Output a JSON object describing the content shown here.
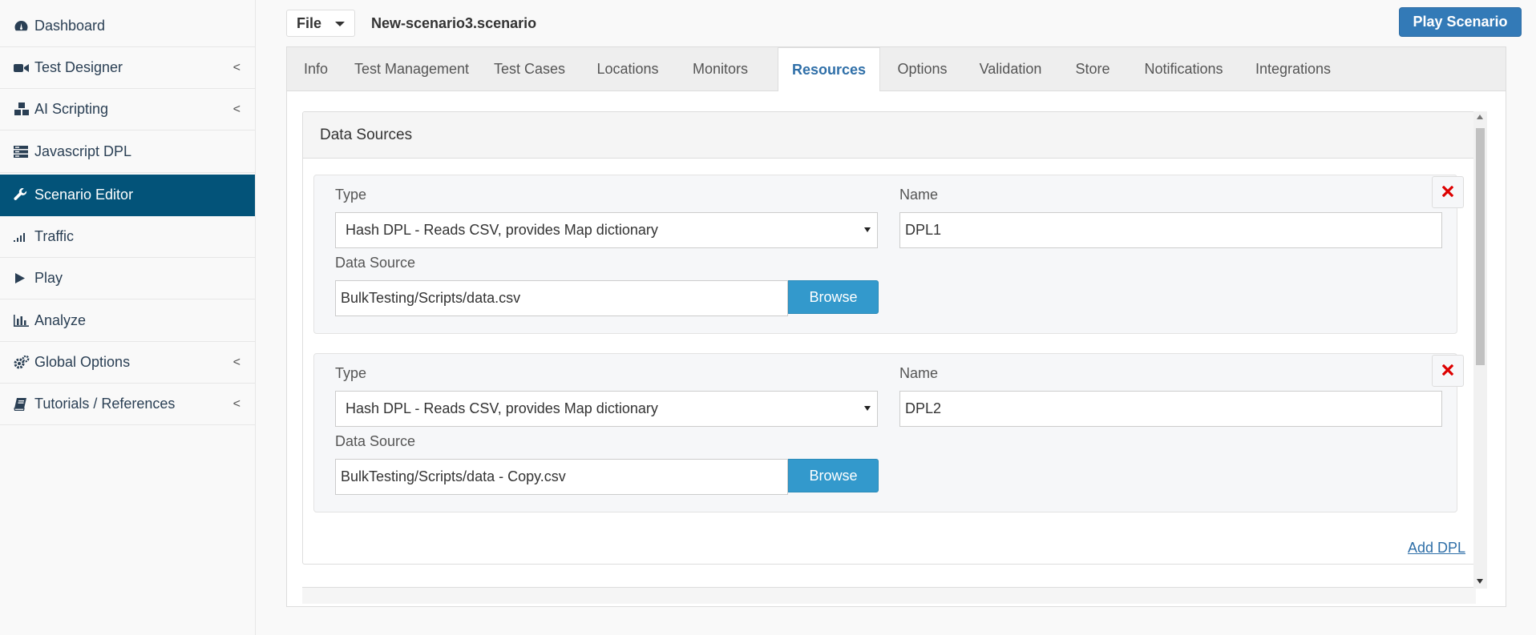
{
  "sidebar": {
    "items": [
      {
        "label": "Dashboard",
        "icon": "dashboard-icon",
        "has_submenu": false
      },
      {
        "label": "Test Designer",
        "icon": "video-camera-icon",
        "has_submenu": true
      },
      {
        "label": "AI Scripting",
        "icon": "cubes-icon",
        "has_submenu": true
      },
      {
        "label": "Javascript DPL",
        "icon": "list-icon",
        "has_submenu": false
      },
      {
        "label": "Scenario Editor",
        "icon": "wrench-icon",
        "has_submenu": false,
        "active": true
      },
      {
        "label": "Traffic",
        "icon": "signal-icon",
        "has_submenu": false
      },
      {
        "label": "Play",
        "icon": "play-icon",
        "has_submenu": false
      },
      {
        "label": "Analyze",
        "icon": "bar-chart-icon",
        "has_submenu": false
      },
      {
        "label": "Global Options",
        "icon": "gears-icon",
        "has_submenu": true
      },
      {
        "label": "Tutorials / References",
        "icon": "book-icon",
        "has_submenu": true
      }
    ],
    "chevron": "<"
  },
  "toolbar": {
    "file_label": "File",
    "scenario_name": "New-scenario3.scenario",
    "play_label": "Play Scenario"
  },
  "tabs": [
    {
      "label": "Info"
    },
    {
      "label": "Test Management"
    },
    {
      "label": "Test Cases"
    },
    {
      "label": "Locations"
    },
    {
      "label": "Monitors"
    },
    {
      "label": "Resources",
      "active": true
    },
    {
      "label": "Options"
    },
    {
      "label": "Validation"
    },
    {
      "label": "Store"
    },
    {
      "label": "Notifications"
    },
    {
      "label": "Integrations"
    }
  ],
  "data_sources": {
    "heading": "Data Sources",
    "type_label": "Type",
    "name_label": "Name",
    "source_label": "Data Source",
    "browse_label": "Browse",
    "add_label": "Add DPL",
    "dpls": [
      {
        "type": "Hash DPL - Reads CSV, provides Map dictionary",
        "name": "DPL1",
        "source": "BulkTesting/Scripts/data.csv"
      },
      {
        "type": "Hash DPL - Reads CSV, provides Map dictionary",
        "name": "DPL2",
        "source": "BulkTesting/Scripts/data - Copy.csv"
      }
    ]
  },
  "colors": {
    "sidebar_active": "#035379",
    "primary_button": "#337ab7",
    "browse_button": "#3399cc",
    "active_tab_text": "#2f6fa8",
    "remove_icon": "#dd0000"
  }
}
